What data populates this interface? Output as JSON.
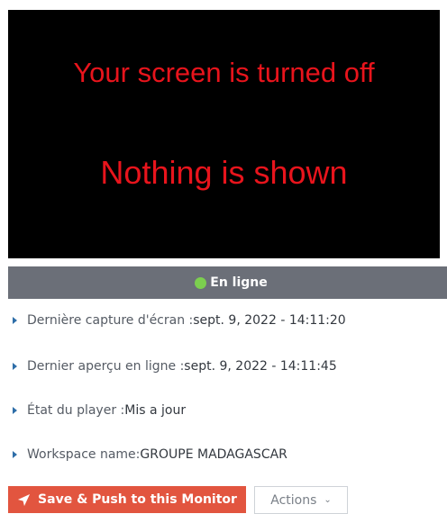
{
  "screen": {
    "line1": "Your screen is turned off",
    "line2": "Nothing is shown",
    "background": "#000000",
    "text_color": "#e8141c"
  },
  "status": {
    "label": "En ligne",
    "dot_color": "#7ccf4f",
    "bar_color": "#6b6f78"
  },
  "info": [
    {
      "label": "Dernière capture d'écran : ",
      "value": "sept. 9, 2022 - 14:11:20"
    },
    {
      "label": "Dernier aperçu en ligne : ",
      "value": "sept. 9, 2022 - 14:11:45"
    },
    {
      "label": "État du player : ",
      "value": "Mis a jour"
    },
    {
      "label": "Workspace name: ",
      "value": "GROUPE MADAGASCAR"
    }
  ],
  "buttons": {
    "push_label": "Save & Push to this Monitor",
    "push_icon": "send-icon",
    "push_color": "#e2553f",
    "actions_label": "Actions",
    "actions_icon": "chevron-down-icon"
  }
}
